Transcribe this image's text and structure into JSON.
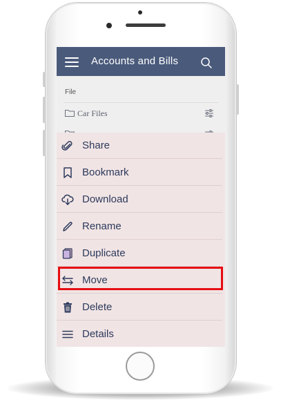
{
  "app": {
    "title": "Accounts and Bills"
  },
  "file_list": {
    "section_label": "File",
    "items": [
      {
        "name": "Car Files"
      }
    ]
  },
  "action_sheet": {
    "items": [
      {
        "label": "Share",
        "icon": "paperclip-icon"
      },
      {
        "label": "Bookmark",
        "icon": "bookmark-icon"
      },
      {
        "label": "Download",
        "icon": "cloud-download-icon"
      },
      {
        "label": "Rename",
        "icon": "pencil-icon"
      },
      {
        "label": "Duplicate",
        "icon": "duplicate-icon"
      },
      {
        "label": "Move",
        "icon": "move-arrows-icon"
      },
      {
        "label": "Delete",
        "icon": "trash-icon"
      },
      {
        "label": "Details",
        "icon": "menu-lines-icon"
      }
    ],
    "highlighted_item": "Move"
  },
  "colors": {
    "appbar": "#4a5a7b",
    "sheet_background": "#f1e4e4",
    "item_text": "#2c3a5c",
    "highlight_border": "#e50d12"
  }
}
